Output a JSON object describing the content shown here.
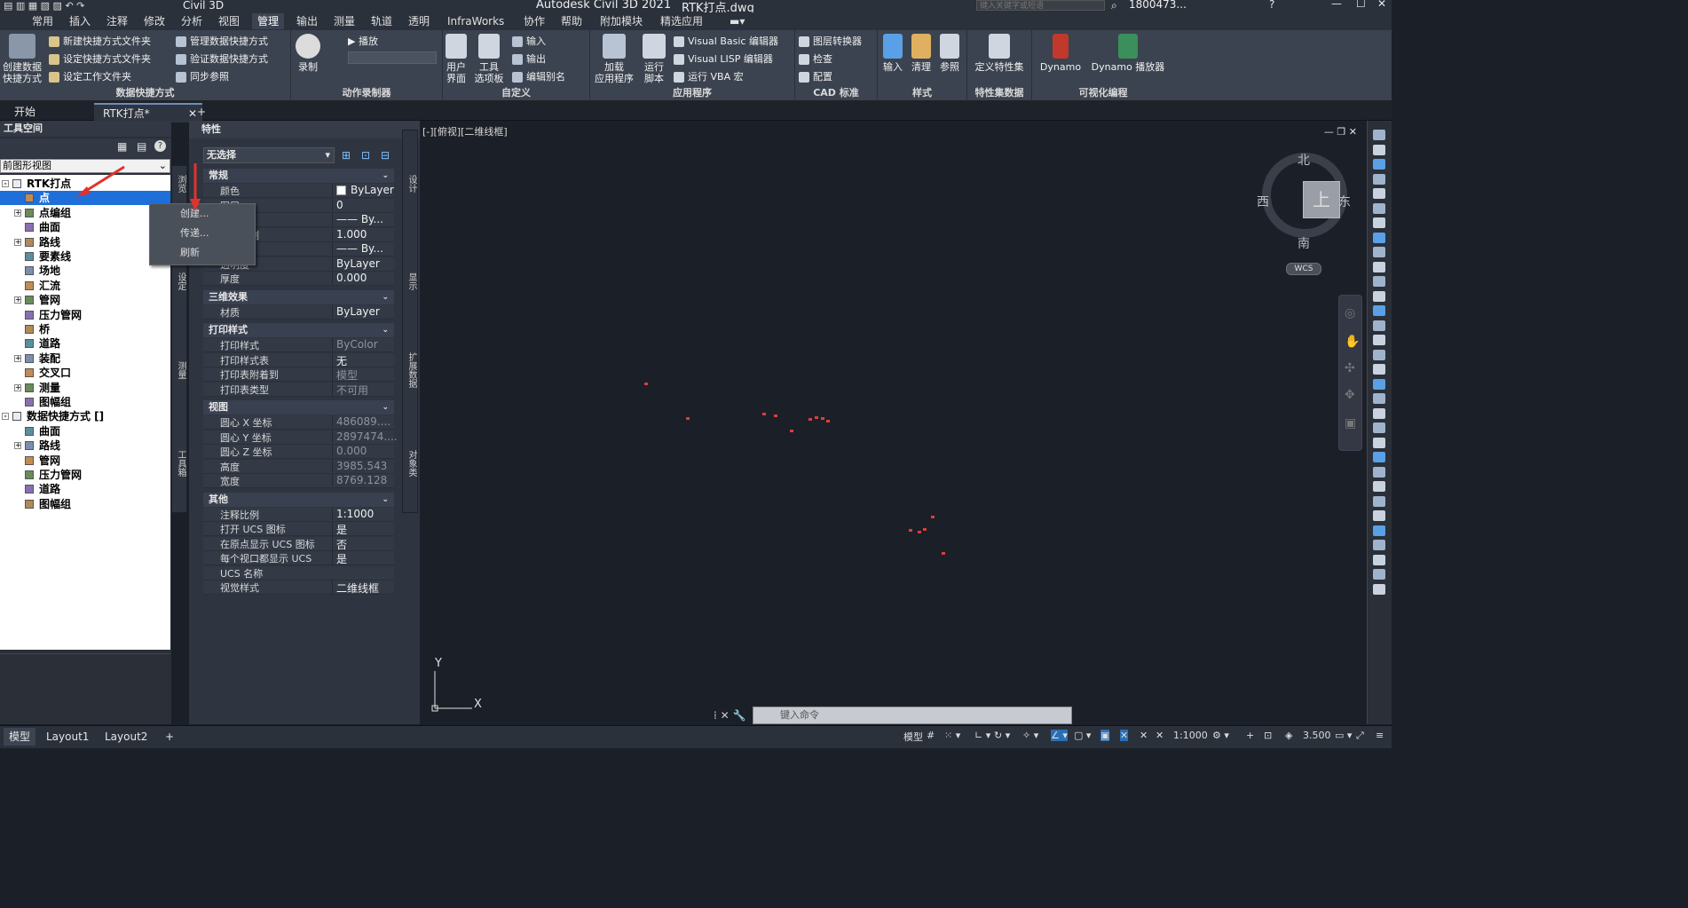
{
  "window": {
    "app_title": "Autodesk Civil 3D 2021",
    "file_title": "RTK打点.dwg",
    "workspace": "Civil 3D",
    "search_placeholder": "键入关键字或短语",
    "user": "1800473..."
  },
  "ribbon_tabs": [
    "常用",
    "插入",
    "注释",
    "修改",
    "分析",
    "视图",
    "管理",
    "输出",
    "测量",
    "轨道",
    "透明",
    "InfraWorks",
    "协作",
    "帮助",
    "附加模块",
    "精选应用"
  ],
  "active_ribbon_tab": "管理",
  "ribbon": {
    "data_shortcuts": {
      "title": "数据快捷方式",
      "big_btn": "创建数据\n快捷方式",
      "items": [
        "新建快捷方式文件夹",
        "设定快捷方式文件夹",
        "设定工作文件夹",
        "管理数据快捷方式",
        "验证数据快捷方式",
        "同步参照"
      ]
    },
    "action_recorder": {
      "title": "动作录制器",
      "record": "录制",
      "play": "播放"
    },
    "customize": {
      "title": "自定义",
      "user_interface": "用户\n界面",
      "tool_palettes": "工具\n选项板",
      "import": "输入",
      "export": "输出",
      "edit_aliases": "编辑别名"
    },
    "applications": {
      "title": "应用程序",
      "load_app": "加载\n应用程序",
      "run_script": "运行\n脚本",
      "vb_editor": "Visual Basic 编辑器",
      "lisp_editor": "Visual LISP 编辑器",
      "vba_macro": "运行 VBA 宏"
    },
    "cad_standards": {
      "title": "CAD 标准",
      "layer_translator": "图层转换器",
      "check": "检查",
      "configure": "配置"
    },
    "styles": {
      "title": "样式",
      "import": "输入",
      "purge": "清理",
      "reference": "参照"
    },
    "feature_data": {
      "title": "特性集数据",
      "define": "定义特性集"
    },
    "visual_programming": {
      "title": "可视化编程",
      "dynamo": "Dynamo",
      "dynamo_player": "Dynamo 播放器"
    }
  },
  "doc_tabs": {
    "start": "开始",
    "active": "RTK打点*"
  },
  "toolspace": {
    "title": "工具空间",
    "combo": "前图形视图",
    "tree": [
      {
        "label": "RTK打点",
        "level": 0,
        "exp": "-"
      },
      {
        "label": "点",
        "level": 1,
        "exp": "",
        "selected": true
      },
      {
        "label": "点编组",
        "level": 1,
        "exp": "+"
      },
      {
        "label": "曲面",
        "level": 1,
        "exp": ""
      },
      {
        "label": "路线",
        "level": 1,
        "exp": "+"
      },
      {
        "label": "要素线",
        "level": 1,
        "exp": ""
      },
      {
        "label": "场地",
        "level": 1,
        "exp": ""
      },
      {
        "label": "汇流",
        "level": 1,
        "exp": ""
      },
      {
        "label": "管网",
        "level": 1,
        "exp": "+"
      },
      {
        "label": "压力管网",
        "level": 1,
        "exp": ""
      },
      {
        "label": "桥",
        "level": 1,
        "exp": ""
      },
      {
        "label": "道路",
        "level": 1,
        "exp": ""
      },
      {
        "label": "装配",
        "level": 1,
        "exp": "+"
      },
      {
        "label": "交叉口",
        "level": 1,
        "exp": ""
      },
      {
        "label": "测量",
        "level": 1,
        "exp": "+"
      },
      {
        "label": "图幅组",
        "level": 1,
        "exp": ""
      },
      {
        "label": "数据快捷方式 []",
        "level": 0,
        "exp": "-"
      },
      {
        "label": "曲面",
        "level": 1,
        "exp": ""
      },
      {
        "label": "路线",
        "level": 1,
        "exp": "+"
      },
      {
        "label": "管网",
        "level": 1,
        "exp": ""
      },
      {
        "label": "压力管网",
        "level": 1,
        "exp": ""
      },
      {
        "label": "道路",
        "level": 1,
        "exp": ""
      },
      {
        "label": "图幅组",
        "level": 1,
        "exp": ""
      }
    ],
    "side_tabs": [
      "浏览",
      "设定",
      "测量",
      "工具箱"
    ]
  },
  "context_menu": [
    "创建...",
    "传递...",
    "刷新"
  ],
  "properties": {
    "title": "特性",
    "selection": "无选择",
    "side_tabs": [
      "设计",
      "显示",
      "扩展数据",
      "对象类"
    ],
    "sections": [
      {
        "title": "常规",
        "rows": [
          {
            "name": "颜色",
            "value": "ByLayer",
            "swatch": true
          },
          {
            "name": "图层",
            "value": "0"
          },
          {
            "name": "线型",
            "value": "—— By..."
          },
          {
            "name": "线型比例",
            "value": "1.000"
          },
          {
            "name": "线宽",
            "value": "—— By..."
          },
          {
            "name": "透明度",
            "value": "ByLayer"
          },
          {
            "name": "厚度",
            "value": "0.000"
          }
        ]
      },
      {
        "title": "三维效果",
        "rows": [
          {
            "name": "材质",
            "value": "ByLayer"
          }
        ]
      },
      {
        "title": "打印样式",
        "rows": [
          {
            "name": "打印样式",
            "value": "ByColor",
            "dim": true
          },
          {
            "name": "打印样式表",
            "value": "无"
          },
          {
            "name": "打印表附着到",
            "value": "模型",
            "dim": true
          },
          {
            "name": "打印表类型",
            "value": "不可用",
            "dim": true
          }
        ]
      },
      {
        "title": "视图",
        "rows": [
          {
            "name": "圆心 X 坐标",
            "value": "486089....",
            "dim": true
          },
          {
            "name": "圆心 Y 坐标",
            "value": "2897474....",
            "dim": true
          },
          {
            "name": "圆心 Z 坐标",
            "value": "0.000",
            "dim": true
          },
          {
            "name": "高度",
            "value": "3985.543",
            "dim": true
          },
          {
            "name": "宽度",
            "value": "8769.128",
            "dim": true
          }
        ]
      },
      {
        "title": "其他",
        "rows": [
          {
            "name": "注释比例",
            "value": "1:1000"
          },
          {
            "name": "打开 UCS 图标",
            "value": "是"
          },
          {
            "name": "在原点显示 UCS 图标",
            "value": "否"
          },
          {
            "name": "每个视口都显示 UCS",
            "value": "是"
          },
          {
            "name": "UCS 名称",
            "value": ""
          },
          {
            "name": "视觉样式",
            "value": "二维线框"
          }
        ]
      }
    ]
  },
  "viewport": {
    "label": "[-][俯视][二维线框]",
    "compass": {
      "north": "北",
      "south": "南",
      "east": "东",
      "west": "西",
      "face": "上"
    },
    "wcs": "WCS",
    "ucs_x": "X",
    "ucs_y": "Y"
  },
  "command_line": {
    "placeholder": "键入命令"
  },
  "status": {
    "tabs": [
      "模型",
      "Layout1",
      "Layout2"
    ],
    "model_label": "模型",
    "scale": "1:1000",
    "value": "3.500"
  },
  "colors": {
    "point": "#e03c3c",
    "selection": "#1e6fd9",
    "background": "#1b1f27"
  }
}
